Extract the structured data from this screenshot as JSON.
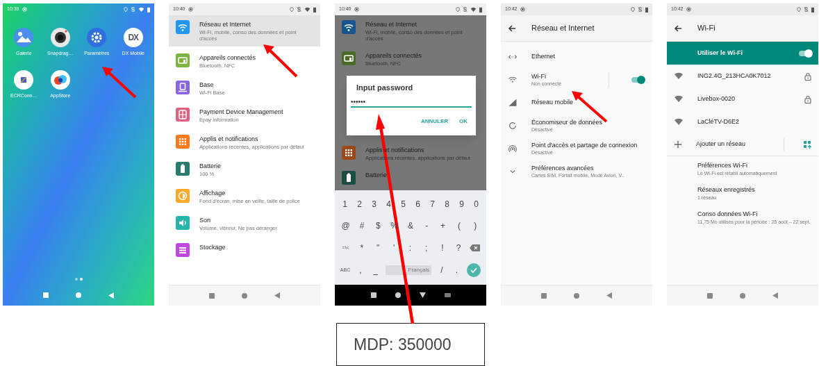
{
  "screens": [
    {
      "kind": "home",
      "status": {
        "time": "10:39",
        "wifi": true
      },
      "apps": [
        {
          "kind": "gallery",
          "label": "Galerie"
        },
        {
          "kind": "camera",
          "label": "Snapdrag…"
        },
        {
          "kind": "settings",
          "label": "Paramètres"
        },
        {
          "kind": "dx",
          "label": "DX Mobile",
          "logo_text": "DX"
        },
        {
          "kind": "ecr",
          "label": "ECRConn…"
        },
        {
          "kind": "appstore",
          "label": "AppStore"
        }
      ],
      "page_dots": [
        {
          "selected": false
        },
        {
          "selected": true
        }
      ]
    },
    {
      "kind": "settings",
      "status": {
        "time": "10:40",
        "wifi": true
      },
      "items": [
        {
          "kind": "wifi",
          "title": "Réseau et Internet",
          "subtitle": "Wi-Fi, mobile, conso des données et point d'accès",
          "color": "#2196f3",
          "selected": true
        },
        {
          "kind": "devices",
          "title": "Appareils connectés",
          "subtitle": "Bluetooth, NFC",
          "color": "#7cb342",
          "selected": false
        },
        {
          "kind": "base",
          "title": "Base",
          "subtitle": "Wi-Fi Base",
          "color": "#8a66e0",
          "selected": false
        },
        {
          "kind": "payment",
          "title": "Payment Device Management",
          "subtitle": "Epay Information",
          "color": "#e06080",
          "selected": false
        },
        {
          "kind": "apps",
          "title": "Applis et notifications",
          "subtitle": "Applications récentes, applications par défaut",
          "color": "#ff7a1a",
          "selected": false
        },
        {
          "kind": "battery",
          "title": "Batterie",
          "subtitle": "100 %",
          "color": "#2a7d6e",
          "selected": false
        },
        {
          "kind": "display",
          "title": "Affichage",
          "subtitle": "Fond d'écran, mise en veille, taille de police",
          "color": "#ffa726",
          "selected": false
        },
        {
          "kind": "sound",
          "title": "Son",
          "subtitle": "Volume, vibreur, Ne pas déranger",
          "color": "#26b5a8",
          "selected": false
        },
        {
          "kind": "storage",
          "title": "Stockage",
          "color": "#c048e0",
          "selected": false
        }
      ]
    },
    {
      "kind": "password",
      "status": {
        "time": "10:40",
        "wifi": true
      },
      "background_items": [
        {
          "kind": "wifi",
          "title": "Réseau et Internet",
          "subtitle": "Wi-Fi, mobile, conso des données et point d'accès",
          "color": "#16568c"
        },
        {
          "kind": "devices",
          "title": "Appareils connectés",
          "subtitle": "Bluetooth, NFC",
          "color": "#4a6b28"
        },
        {
          "kind": "apps",
          "title": "Applis et notifications",
          "subtitle": "Applications récentes, applications par défaut",
          "color": "#99491a"
        },
        {
          "kind": "battery",
          "title": "Batterie",
          "color": "#1a4d44"
        }
      ],
      "dialog": {
        "title": "Input password",
        "value": "••••••",
        "buttons": [
          "ANNULER",
          "OK"
        ]
      },
      "keyboard": [
        [
          {
            "kind": "char",
            "label": "1"
          },
          {
            "kind": "char",
            "label": "2"
          },
          {
            "kind": "char",
            "label": "3"
          },
          {
            "kind": "char",
            "label": "4"
          },
          {
            "kind": "char",
            "label": "5"
          },
          {
            "kind": "char",
            "label": "6"
          },
          {
            "kind": "char",
            "label": "7"
          },
          {
            "kind": "char",
            "label": "8"
          },
          {
            "kind": "char",
            "label": "9"
          },
          {
            "kind": "char",
            "label": "0"
          }
        ],
        [
          {
            "kind": "char",
            "label": "@"
          },
          {
            "kind": "char",
            "label": "#"
          },
          {
            "kind": "char",
            "label": "$"
          },
          {
            "kind": "char",
            "label": "%"
          },
          {
            "kind": "char",
            "label": "&"
          },
          {
            "kind": "char",
            "label": "-"
          },
          {
            "kind": "char",
            "label": "+"
          },
          {
            "kind": "char",
            "label": "("
          },
          {
            "kind": "char",
            "label": ")"
          }
        ],
        [
          {
            "kind": "small",
            "label": "=\\<"
          },
          {
            "kind": "char",
            "label": "*"
          },
          {
            "kind": "char",
            "label": "\""
          },
          {
            "kind": "char",
            "label": "'"
          },
          {
            "kind": "char",
            "label": ":"
          },
          {
            "kind": "char",
            "label": ";"
          },
          {
            "kind": "char",
            "label": "!"
          },
          {
            "kind": "char",
            "label": "?"
          },
          {
            "kind": "backspace"
          }
        ],
        [
          {
            "kind": "small",
            "label": "ABC"
          },
          {
            "kind": "char",
            "label": ","
          },
          {
            "kind": "char",
            "label": "_"
          },
          {
            "kind": "space",
            "label": "Français"
          },
          {
            "kind": "char",
            "label": "/"
          },
          {
            "kind": "char",
            "label": "."
          },
          {
            "kind": "done"
          }
        ]
      ]
    },
    {
      "kind": "network",
      "status": {
        "time": "10:42",
        "wifi": false
      },
      "title": "Réseau et Internet",
      "items": [
        {
          "kind": "ethernet",
          "title": "Ethernet"
        },
        {
          "kind": "wifi",
          "title": "Wi-Fi",
          "subtitle": "Non connecté",
          "toggle": true
        },
        {
          "kind": "mobile",
          "title": "Réseau mobile"
        },
        {
          "kind": "saver",
          "title": "Économiseur de données",
          "subtitle": "Désactivé"
        },
        {
          "kind": "hotspot",
          "title": "Point d'accès et partage de connexion",
          "subtitle": "Désactivé"
        },
        {
          "kind": "advanced",
          "title": "Préférences avancées",
          "subtitle": "Cartes SIM, Forfait mobile, Mode Avion, V.."
        }
      ]
    },
    {
      "kind": "wifi",
      "status": {
        "time": "10:42",
        "wifi": false
      },
      "title": "Wi-Fi",
      "master": {
        "label": "Utiliser le Wi-Fi",
        "on": true
      },
      "networks": [
        {
          "ssid": "ING2.4G_213HCA0K7012",
          "locked": true
        },
        {
          "ssid": "Livebox-0020",
          "locked": true
        },
        {
          "ssid": "LaCléTV-D6E2",
          "locked": false
        }
      ],
      "add_network": "Ajouter un réseau",
      "prefs": [
        {
          "title": "Préférences Wi-Fi",
          "subtitle": "Le Wi-Fi est rétabli automatiquement"
        },
        {
          "title": "Réseaux enregistrés",
          "subtitle": "1 réseau"
        },
        {
          "title": "Conso données Wi-Fi",
          "subtitle": "11,75 Mo utilisés pour la période : 25 août – 22 sept."
        }
      ]
    }
  ],
  "note": "MDP: 350000"
}
